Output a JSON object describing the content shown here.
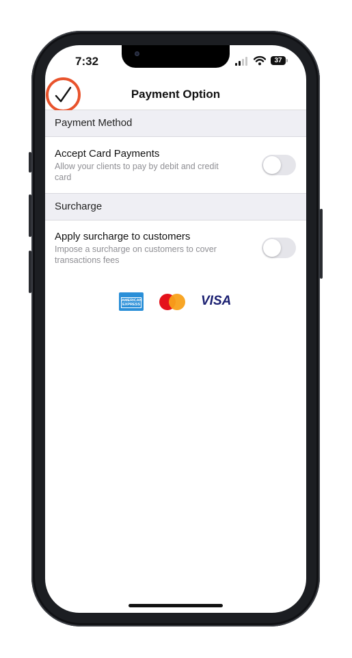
{
  "status_bar": {
    "time": "7:32",
    "battery": "37"
  },
  "nav": {
    "title": "Payment Option",
    "done_icon": "checkmark-icon"
  },
  "sections": [
    {
      "header": "Payment Method",
      "row": {
        "title": "Accept Card Payments",
        "subtitle": "Allow your clients to pay by debit and credit card",
        "toggle_on": false
      }
    },
    {
      "header": "Surcharge",
      "row": {
        "title": "Apply surcharge to customers",
        "subtitle": "Impose a surcharge on customers to cover transactions fees",
        "toggle_on": false
      }
    }
  ],
  "card_logos": {
    "amex_line1": "AMERICAN",
    "amex_line2": "EXPRESS",
    "visa": "VISA",
    "mastercard": "mastercard-logo"
  },
  "colors": {
    "highlight_ring": "#e8532c",
    "section_bg": "#efeff4",
    "toggle_off": "#e5e5ea"
  }
}
